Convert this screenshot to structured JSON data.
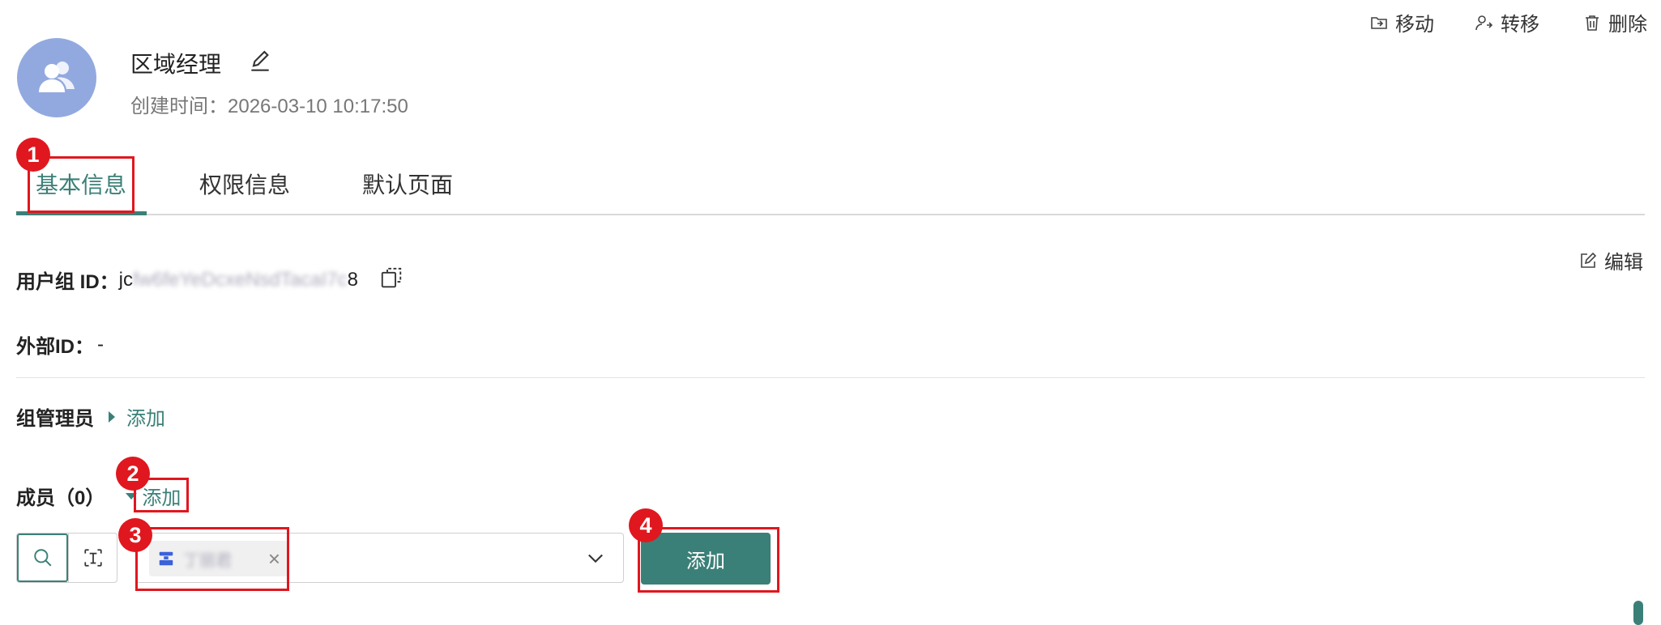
{
  "top_actions": {
    "move": "移动",
    "transfer": "转移",
    "delete": "删除"
  },
  "header": {
    "group_name": "区域经理",
    "created_label": "创建时间：",
    "created_time": "2026-03-10 10:17:50"
  },
  "tabs": [
    {
      "label": "基本信息",
      "active": true
    },
    {
      "label": "权限信息",
      "active": false
    },
    {
      "label": "默认页面",
      "active": false
    }
  ],
  "info": {
    "edit_label": "编辑",
    "group_id_label": "用户组 ID：",
    "group_id_value_prefix": "jc",
    "group_id_value_blurred": "fw6feYeDcxeNsdTacaI7c",
    "group_id_value_suffix": "8",
    "external_id_label": "外部ID：",
    "external_id_value": "-"
  },
  "admins": {
    "label": "组管理员",
    "add_link": "添加"
  },
  "members": {
    "label": "成员（0）",
    "add_link": "添加",
    "selected_tag": "丁丽君",
    "add_button": "添加"
  },
  "annotations": [
    "1",
    "2",
    "3",
    "4"
  ],
  "colors": {
    "accent": "#3b8078",
    "annotation": "#e0171f",
    "avatar": "#92a9e0"
  }
}
